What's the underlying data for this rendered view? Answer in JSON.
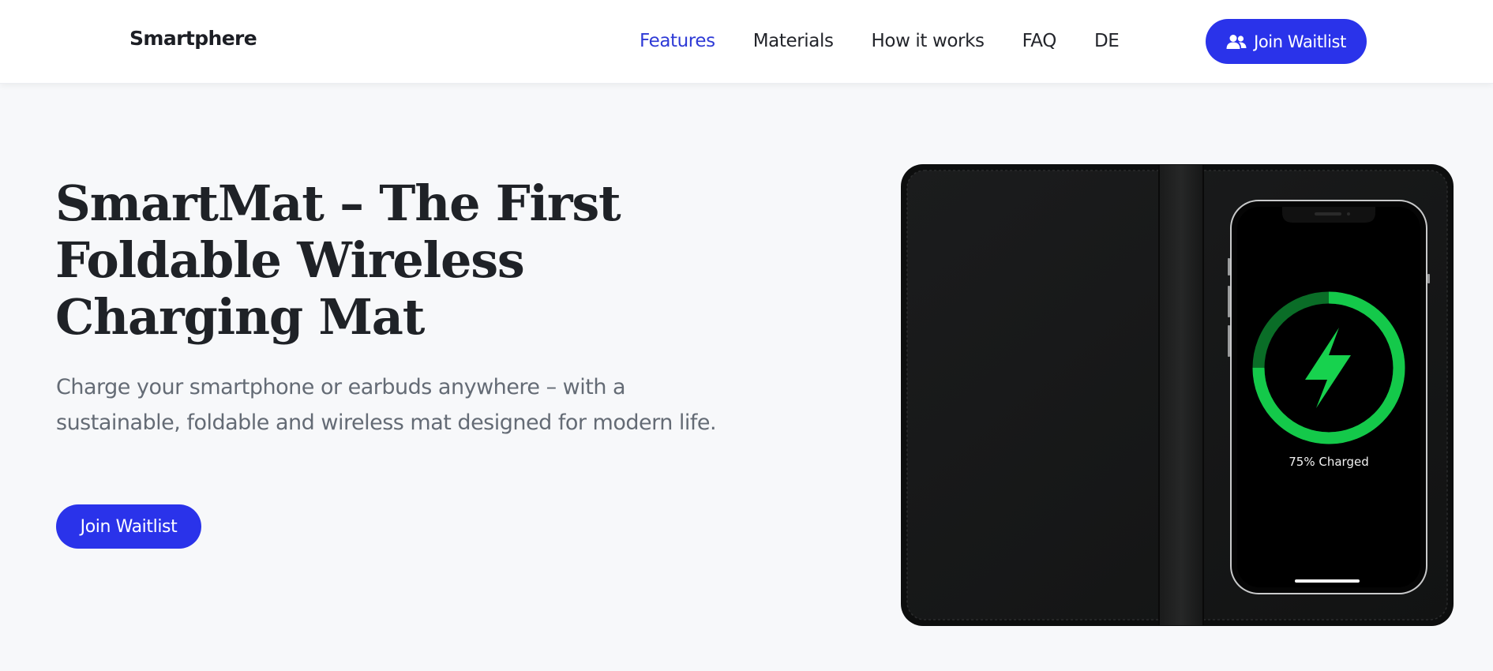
{
  "header": {
    "brand": "Smartphere",
    "nav": [
      {
        "label": "Features",
        "active": true
      },
      {
        "label": "Materials",
        "active": false
      },
      {
        "label": "How it works",
        "active": false
      },
      {
        "label": "FAQ",
        "active": false
      },
      {
        "label": "DE",
        "active": false
      }
    ],
    "cta_label": "Join Waitlist",
    "cta_icon": "users-icon"
  },
  "hero": {
    "title": "SmartMat – The First Foldable Wireless Charging Mat",
    "subtitle": "Charge your smartphone or earbuds anywhere – with a sustainable, foldable and wireless mat designed for modern life.",
    "cta_label": "Join Waitlist"
  },
  "product": {
    "phone_status": "75% Charged",
    "charge_level": 0.75,
    "charge_icon": "lightning-bolt-icon"
  },
  "colors": {
    "accent": "#2a33ea",
    "nav_active": "#2e3ad6",
    "charge_green": "#14c94a"
  }
}
